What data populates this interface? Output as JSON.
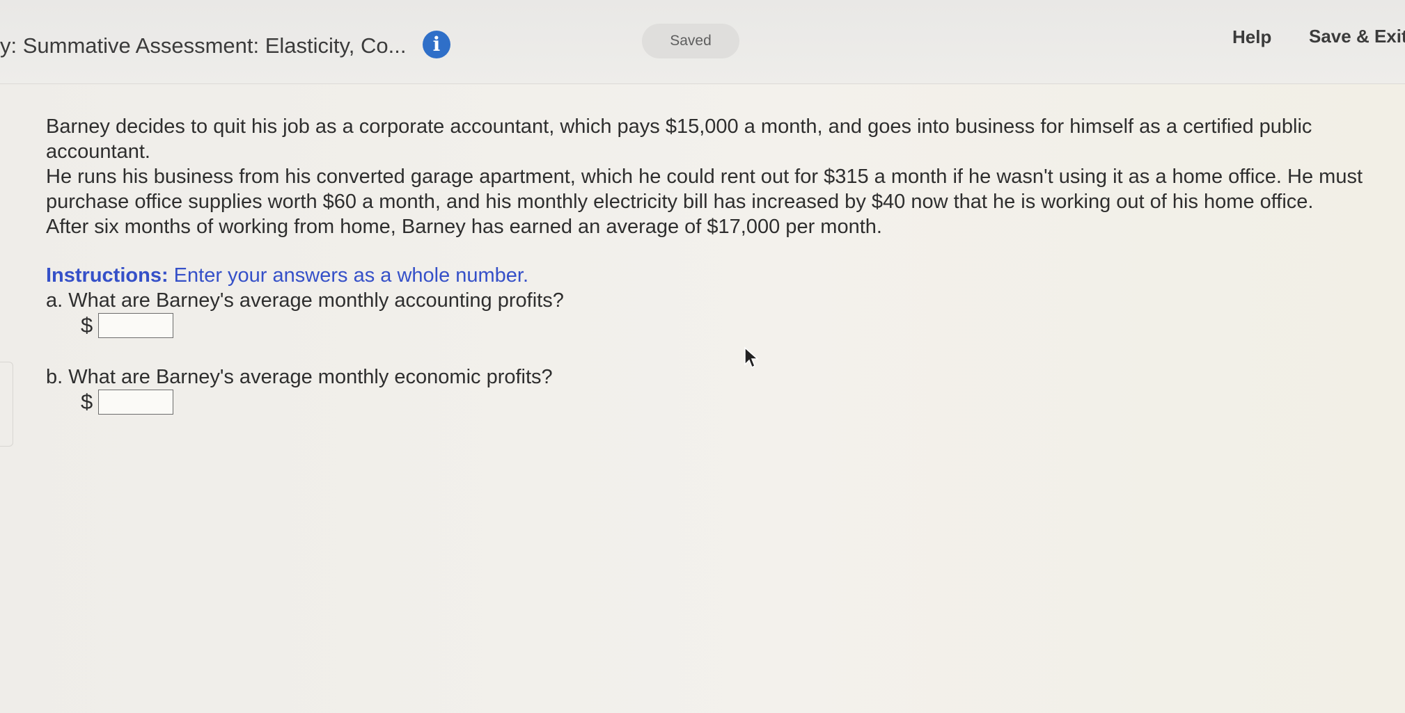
{
  "header": {
    "title": "y: Summative Assessment: Elasticity, Co...",
    "info_icon": "info-icon",
    "saved_label": "Saved",
    "help_label": "Help",
    "save_exit_label": "Save & Exit"
  },
  "problem": {
    "paragraph_1": "Barney decides to quit his job as a corporate accountant, which pays $15,000 a month, and goes into business for himself as a certified public accountant.",
    "paragraph_2": "He runs his business from his converted garage apartment, which he could rent out for $315 a month if he wasn't using it as a home office. He must purchase office supplies worth $60 a month, and his monthly electricity bill has increased by $40 now that he is working out of his home office.",
    "paragraph_3": "After six months of working from home, Barney has earned an average of $17,000 per month."
  },
  "instructions": {
    "label": "Instructions:",
    "text": " Enter your answers as a whole number."
  },
  "questions": [
    {
      "text": "a. What are Barney's average monthly accounting profits?",
      "currency": "$",
      "value": ""
    },
    {
      "text": "b. What are Barney's average monthly economic profits?",
      "currency": "$",
      "value": ""
    }
  ],
  "colors": {
    "accent_blue": "#2f6fc8",
    "instructions_blue": "#3550c8"
  }
}
